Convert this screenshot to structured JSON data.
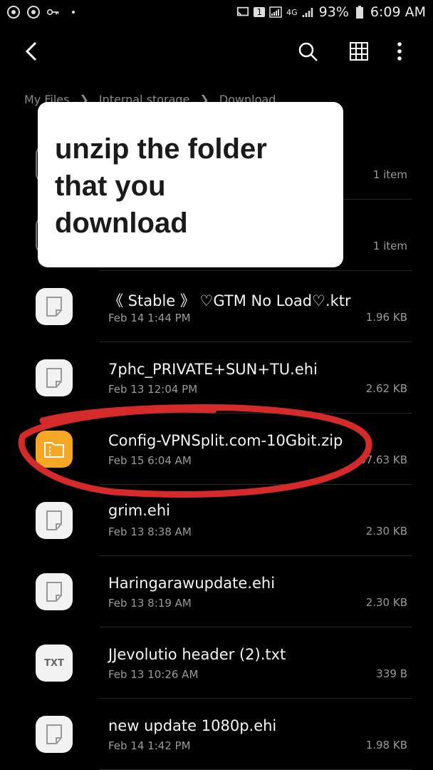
{
  "status_bar": {
    "signal_label": "4G",
    "battery": "93%",
    "time": "6:09 AM",
    "sim_badge": "1"
  },
  "toolbar": {
    "back_icon": "chevron-left-icon",
    "search_icon": "search-icon",
    "grid_icon": "grid-view-icon",
    "more_icon": "more-vert-icon"
  },
  "breadcrumb": [
    "My Files",
    "Internal storage",
    "Download"
  ],
  "callout": {
    "lines": [
      "unzip the folder",
      "that you",
      "download"
    ]
  },
  "folders": [
    {
      "size": "1 item"
    },
    {
      "size": "1 item"
    }
  ],
  "files": [
    {
      "name": "《 Stable 》 ♡GTM No Load♡.ktr",
      "date": "Feb 14 1:44 PM",
      "size": "1.96 KB",
      "type": "doc"
    },
    {
      "name": "7phc_PRIVATE+SUN+TU.ehi",
      "date": "Feb 13 12:04 PM",
      "size": "2.62 KB",
      "type": "doc"
    },
    {
      "name": "Config-VPNSplit.com-10Gbit.zip",
      "date": "Feb 15 6:04 AM",
      "size": "67.63 KB",
      "type": "zip"
    },
    {
      "name": "grim.ehi",
      "date": "Feb 13 8:38 AM",
      "size": "2.30 KB",
      "type": "doc"
    },
    {
      "name": "Haringarawupdate.ehi",
      "date": "Feb 13 8:19 AM",
      "size": "2.30 KB",
      "type": "doc"
    },
    {
      "name": "JJevolutio header (2).txt",
      "date": "Feb 13 10:26 AM",
      "size": "339 B",
      "type": "txt",
      "icon_label": "TXT"
    },
    {
      "name": "new update 1080p.ehi",
      "date": "Feb 14 1:42 PM",
      "size": "1.98 KB",
      "type": "doc"
    }
  ],
  "highlight_color": "#d42a2a"
}
